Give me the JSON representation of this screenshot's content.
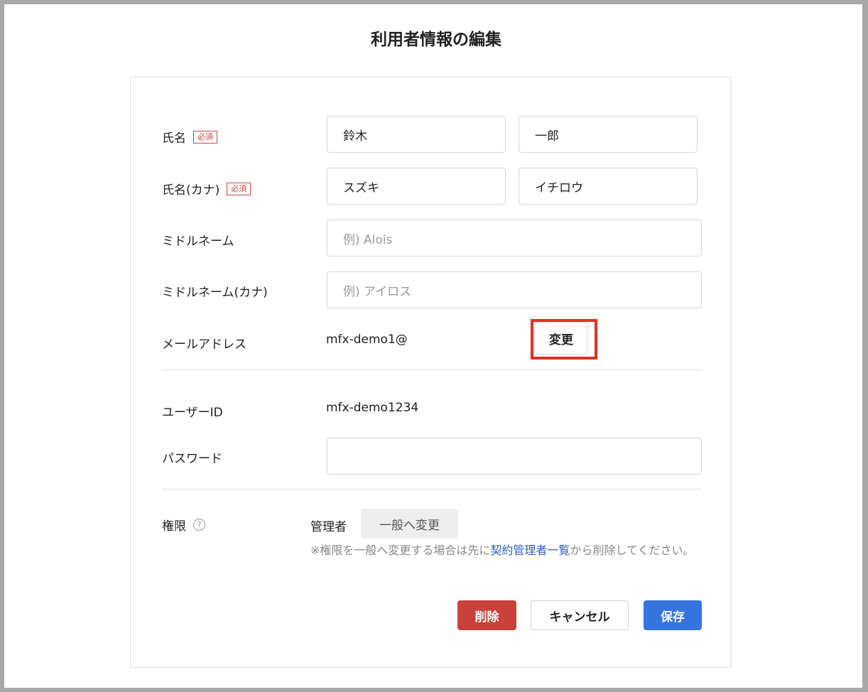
{
  "page": {
    "title": "利用者情報の編集"
  },
  "form": {
    "name": {
      "label": "氏名",
      "required_badge": "必須",
      "last": "鈴木",
      "first": "一郎"
    },
    "name_kana": {
      "label": "氏名(カナ)",
      "required_badge": "必須",
      "last": "スズキ",
      "first": "イチロウ"
    },
    "middle_name": {
      "label": "ミドルネーム",
      "placeholder": "例) Alois",
      "value": ""
    },
    "middle_name_kana": {
      "label": "ミドルネーム(カナ)",
      "placeholder": "例) アイロス",
      "value": ""
    },
    "email": {
      "label": "メールアドレス",
      "value": "mfx-demo1@",
      "change_label": "変更"
    },
    "user_id": {
      "label": "ユーザーID",
      "value": "mfx-demo1234"
    },
    "password": {
      "label": "パスワード",
      "value": ""
    },
    "role": {
      "label": "権限",
      "help_icon": "question-circle-icon",
      "value": "管理者",
      "change_general_label": "一般へ変更",
      "note_prefix": "※権限を一般へ変更する場合は先に",
      "note_link": "契約管理者一覧",
      "note_suffix": "から削除してください。"
    }
  },
  "actions": {
    "delete_label": "削除",
    "cancel_label": "キャンセル",
    "save_label": "保存"
  },
  "colors": {
    "danger": "#c9423a",
    "primary": "#3574e0",
    "highlight": "#e53023",
    "required": "#d0463f",
    "link": "#2f5fc2"
  }
}
